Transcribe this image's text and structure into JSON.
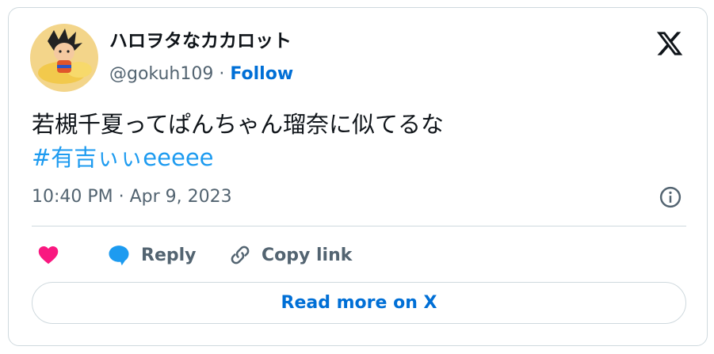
{
  "author": {
    "display_name": "ハロヲタなカカロット",
    "handle": "@gokuh109",
    "separator": "·",
    "follow_label": "Follow"
  },
  "tweet": {
    "text": "若槻千夏ってぱんちゃん瑠奈に似てるな",
    "hashtag": "#有吉ぃぃeeeee",
    "timestamp": "10:40 PM · Apr 9, 2023"
  },
  "actions": {
    "like_label": "",
    "reply_label": "Reply",
    "copy_link_label": "Copy link"
  },
  "read_more_label": "Read more on X",
  "icons": {
    "brand": "x-logo-icon",
    "info": "info-icon",
    "like": "heart-icon",
    "reply": "speech-bubble-icon",
    "copy": "link-icon"
  },
  "colors": {
    "link_blue": "#006fd6",
    "hashtag_blue": "#1d9bf0",
    "like_pink": "#f91880",
    "reply_blue": "#1d9bf0",
    "muted": "#536471",
    "border": "#cfd9de"
  }
}
